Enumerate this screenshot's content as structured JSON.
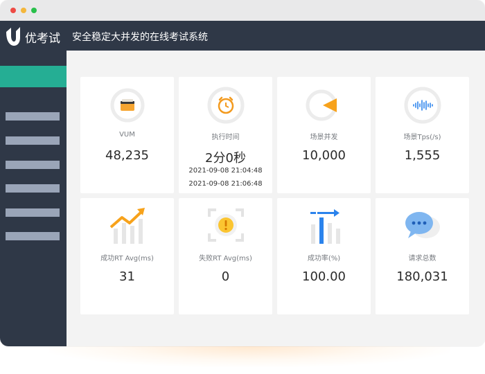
{
  "app": {
    "brand": "优考试",
    "tagline": "安全稳定大并发的在线考试系统"
  },
  "sidebar": {
    "items": [
      "",
      "",
      "",
      "",
      "",
      ""
    ],
    "active_color": "#25ae94"
  },
  "cards": [
    {
      "label": "VUM",
      "value": "48,235",
      "icon": "wallet-icon"
    },
    {
      "label": "执行时间",
      "value": "2分0秒",
      "start": "2021-09-08 21:04:48",
      "end": "2021-09-08 21:06:48",
      "icon": "alarm-clock-icon"
    },
    {
      "label": "场景并发",
      "value": "10,000",
      "icon": "play-triangle-icon"
    },
    {
      "label": "场景Tps(/s)",
      "value": "1,555",
      "icon": "sound-wave-icon"
    },
    {
      "label": "成功RT Avg(ms)",
      "value": "31",
      "icon": "trend-up-chart-icon"
    },
    {
      "label": "失败RT Avg(ms)",
      "value": "0",
      "icon": "warning-scan-icon"
    },
    {
      "label": "成功率(%)",
      "value": "100.00",
      "icon": "bar-chart-icon"
    },
    {
      "label": "请求总数",
      "value": "180,031",
      "icon": "chat-bubble-icon"
    }
  ],
  "colors": {
    "header": "#2f3847",
    "accent_orange": "#f7a21b",
    "accent_blue": "#2b83ec"
  }
}
